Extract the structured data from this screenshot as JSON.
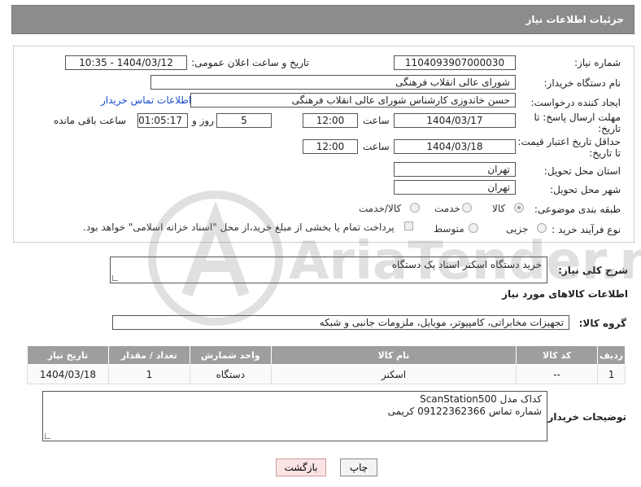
{
  "header": {
    "title": "جزئیات اطلاعات نیاز"
  },
  "fields": {
    "need_number_label": "شماره نیاز:",
    "need_number": "1104093907000030",
    "announce_label": "تاریخ و ساعت اعلان عمومی:",
    "announce_value": "1404/03/12 - 10:35",
    "buyer_org_label": "نام دستگاه خریدار:",
    "buyer_org": "شورای عالی انقلاب فرهنگی",
    "creator_label": "ایجاد کننده درخواست:",
    "creator": "حسن خاندوزی کارشناس شورای عالی انقلاب فرهنگی",
    "contact_link": "اطلاعات تماس خریدار",
    "deadline_label_1": "مهلت ارسال پاسخ: تا",
    "deadline_label_2": "تاریخ:",
    "deadline_date": "1404/03/17",
    "time_label": "ساعت",
    "deadline_time": "12:00",
    "days_value": "5",
    "days_label": "روز و",
    "remaining_time": "01:05:17",
    "remaining_label": "ساعت باقی مانده",
    "validity_label_1": "حداقل تاریخ اعتبار قیمت:",
    "validity_label_2": "تا تاریخ:",
    "validity_date": "1404/03/18",
    "validity_time": "12:00",
    "province_label": "استان محل تحویل:",
    "province": "تهران",
    "city_label": "شهر محل تحویل:",
    "city": "تهران",
    "category_label": "طبقه بندی موضوعی:",
    "category_options": [
      "کالا",
      "خدمت",
      "کالا/خدمت"
    ],
    "category_selected": "کالا",
    "process_label": "نوع فرآیند خرید :",
    "process_options": [
      "جزیی",
      "متوسط"
    ],
    "payment_note": "پرداخت تمام یا بخشی از مبلغ خرید،از محل \"اسناد خزانه اسلامی\" خواهد بود."
  },
  "description": {
    "label": "شرح کلی نیاز:",
    "text": "خرید دستگاه اسکنر اسناد یک دستگاه"
  },
  "goods": {
    "section_title": "اطلاعات کالاهای مورد نیاز",
    "group_label": "گروه کالا:",
    "group_value": "تجهیزات مخابراتی، کامپیوتر، موبایل، ملزومات جانبی و شبکه",
    "columns": [
      "ردیف",
      "کد کالا",
      "نام کالا",
      "واحد شمارش",
      "تعداد / مقدار",
      "تاریخ نیاز"
    ],
    "rows": [
      [
        "1",
        "--",
        "اسکنر",
        "دستگاه",
        "1",
        "1404/03/18"
      ]
    ]
  },
  "buyer_notes": {
    "label": "توضیحات خریدار:",
    "line1": "کداک مدل ScanStation500",
    "line2": "شماره تماس 09122362366 کریمی"
  },
  "buttons": {
    "print": "چاپ",
    "back": "بازگشت"
  },
  "watermark": {
    "text": "AriaTender.net"
  }
}
